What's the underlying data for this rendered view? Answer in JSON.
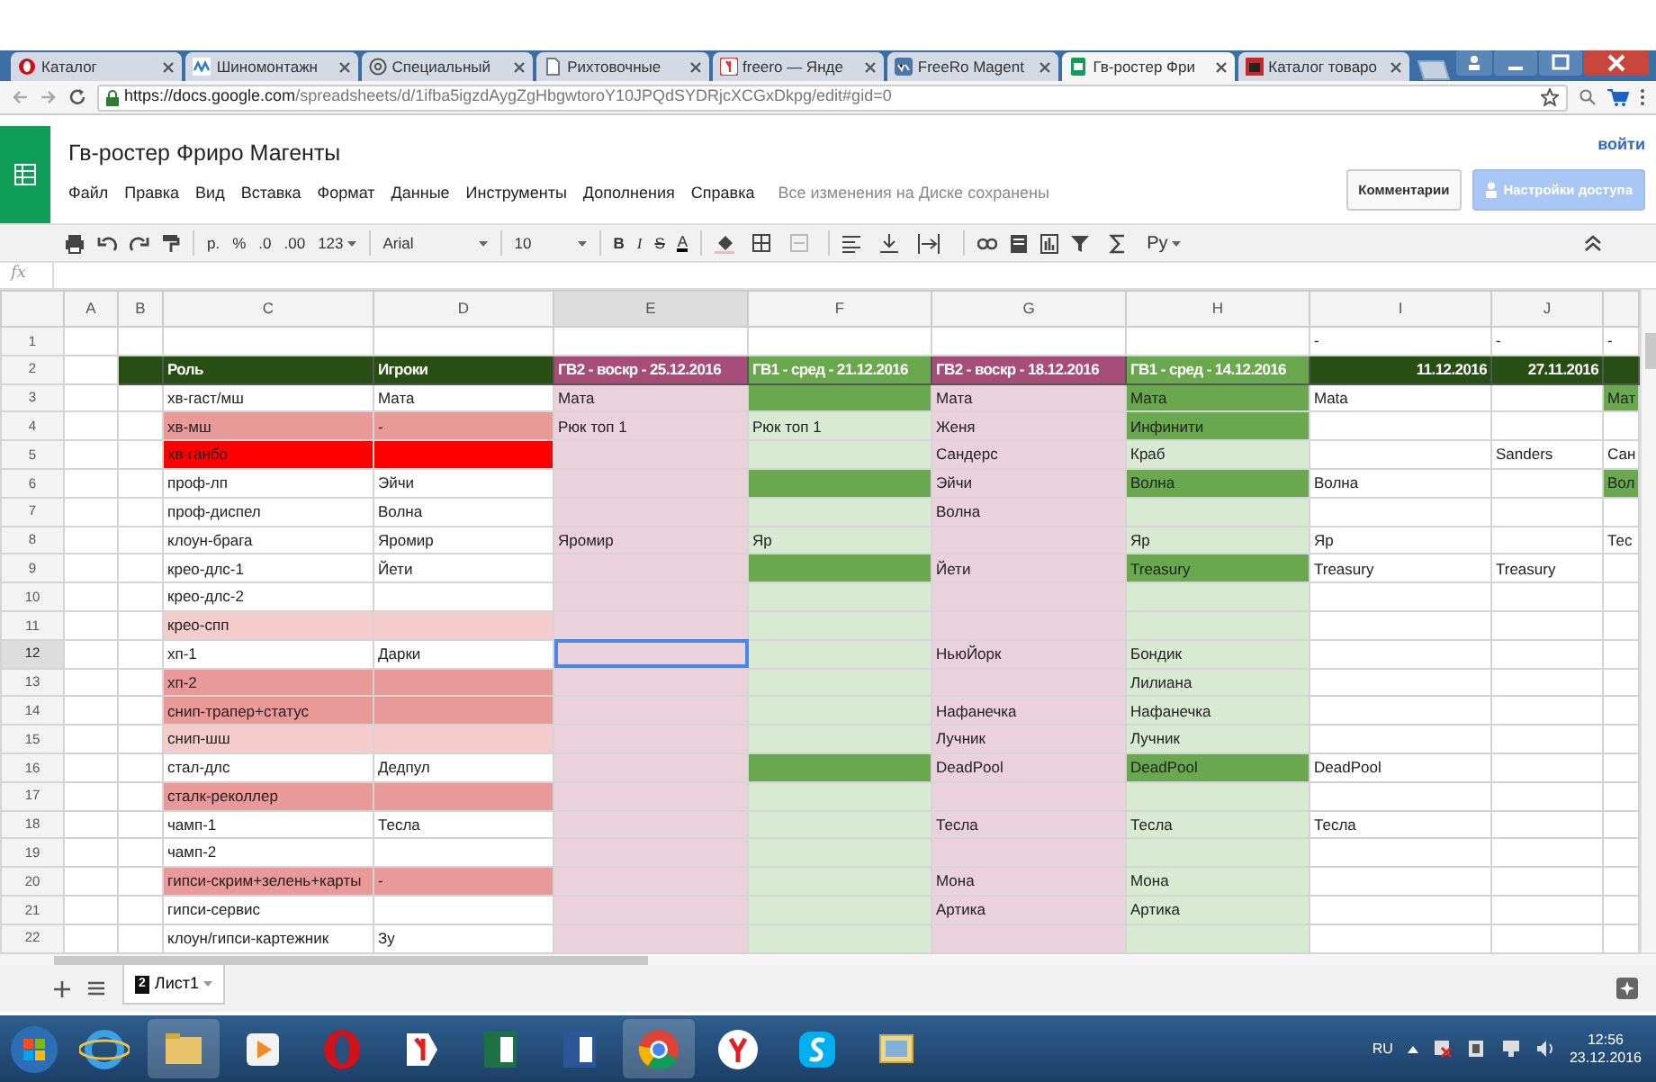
{
  "browser": {
    "tabs": [
      {
        "label": "Каталог",
        "selected": false
      },
      {
        "label": "Шиномонтажн",
        "selected": false
      },
      {
        "label": "Специальный",
        "selected": false
      },
      {
        "label": "Рихтовочные",
        "selected": false
      },
      {
        "label": "freero — Янде",
        "selected": false
      },
      {
        "label": "FreeRo Magent",
        "selected": false
      },
      {
        "label": "Гв-ростер Фри",
        "selected": true
      },
      {
        "label": "Каталог товаро",
        "selected": false
      }
    ],
    "url": {
      "host": "https://docs.google.com",
      "path": "/spreadsheets/d/1ifba5igzdAygZgHbgwtoroY10JPQdSYDRjcXCGxDkpg/edit#gid=0"
    }
  },
  "doc": {
    "title": "Гв-ростер Фриро Магенты",
    "menu": [
      "Файл",
      "Правка",
      "Вид",
      "Вставка",
      "Формат",
      "Данные",
      "Инструменты",
      "Дополнения",
      "Справка"
    ],
    "save_status": "Все изменения на Диске сохранены",
    "sign_in": "войти",
    "buttons": [
      {
        "label": "Комментарии",
        "kind": "secondary"
      },
      {
        "label": "Настройки доступа",
        "kind": "share"
      }
    ]
  },
  "toolbar": {
    "currency": "р.",
    "percent": "%",
    "decrease_decimals": ".0",
    "increase_decimals": ".00",
    "number_format": "123",
    "font": "Arial",
    "font_size": "10",
    "bold": "B",
    "italic": "I",
    "strikethrough": "S",
    "text_color": "A",
    "input_tools": "Ру"
  },
  "formula_bar": {
    "label": "fx"
  },
  "sheet": {
    "columns": [
      {
        "label": "A",
        "selected": false
      },
      {
        "label": "B",
        "selected": false
      },
      {
        "label": "C",
        "selected": false
      },
      {
        "label": "D",
        "selected": false
      },
      {
        "label": "E",
        "selected": true
      },
      {
        "label": "F",
        "selected": false
      },
      {
        "label": "G",
        "selected": false
      },
      {
        "label": "H",
        "selected": false
      },
      {
        "label": "I",
        "selected": false
      },
      {
        "label": "J",
        "selected": false
      },
      {
        "selected": false
      }
    ],
    "rows": [
      {
        "number": "1",
        "selected": false,
        "kind": "plain",
        "cells": [
          {
            "color": "#ffffff"
          },
          {
            "color": "#ffffff"
          },
          {
            "color": "#ffffff"
          },
          {
            "color": "#ffffff"
          },
          {
            "color": "#ffffff"
          },
          {
            "color": "#ffffff"
          },
          {
            "color": "#ffffff"
          },
          {
            "color": "#ffffff"
          },
          {
            "color": "#ffffff",
            "text": "-"
          },
          {
            "color": "#ffffff",
            "text": "-"
          },
          {
            "color": "#ffffff",
            "text": "-"
          }
        ]
      },
      {
        "number": "2",
        "selected": false,
        "kind": "header",
        "cells": [
          {
            "color": "#ffffff"
          },
          {
            "color": "#274e13"
          },
          {
            "color": "#274e13",
            "text": "Роль"
          },
          {
            "color": "#274e13",
            "text": "Игроки"
          },
          {
            "color": "#a64d79",
            "text": "ГВ2 - воскр - 25.12.2016"
          },
          {
            "color": "#6aa84f",
            "text": "ГВ1 - сред - 21.12.2016"
          },
          {
            "color": "#a64d79",
            "text": "ГВ2 - воскр - 18.12.2016"
          },
          {
            "color": "#6aa84f",
            "text": "ГВ1 - сред - 14.12.2016"
          },
          {
            "color": "#274e13",
            "text": "11.12.2016"
          },
          {
            "color": "#274e13",
            "text": "27.11.2016"
          },
          {
            "color": "#274e13"
          }
        ]
      },
      {
        "number": "3",
        "selected": false,
        "kind": "plain",
        "cells": [
          {
            "color": "#ffffff"
          },
          {
            "color": "#ffffff"
          },
          {
            "color": "#ffffff",
            "text": "хв-гаст/мш"
          },
          {
            "color": "#ffffff",
            "text": "Мата"
          },
          {
            "color": "#ead1dc",
            "text": "Мата"
          },
          {
            "color": "#6aa84f"
          },
          {
            "color": "#ead1dc",
            "text": "Мата"
          },
          {
            "color": "#6aa84f",
            "text": "Мата"
          },
          {
            "color": "#ffffff",
            "text": "Mata"
          },
          {
            "color": "#ffffff"
          },
          {
            "color": "#6aa84f",
            "text": "Мат"
          }
        ]
      },
      {
        "number": "4",
        "selected": false,
        "kind": "plain",
        "cells": [
          {
            "color": "#ffffff"
          },
          {
            "color": "#ffffff"
          },
          {
            "color": "#ea9999",
            "text": "хв-мш"
          },
          {
            "color": "#ea9999",
            "text": "-"
          },
          {
            "color": "#ead1dc",
            "text": "Рюк топ 1"
          },
          {
            "color": "#d9ead3",
            "text": "Рюк топ 1"
          },
          {
            "color": "#ead1dc",
            "text": "Женя"
          },
          {
            "color": "#6aa84f",
            "text": "Инфинити"
          },
          {
            "color": "#ffffff"
          },
          {
            "color": "#ffffff"
          },
          {
            "color": "#ffffff"
          }
        ]
      },
      {
        "number": "5",
        "selected": false,
        "kind": "plain",
        "cells": [
          {
            "color": "#ffffff"
          },
          {
            "color": "#ffffff"
          },
          {
            "color": "#ff0000",
            "text": "хв-ганбо"
          },
          {
            "color": "#ff0000"
          },
          {
            "color": "#ead1dc"
          },
          {
            "color": "#d9ead3"
          },
          {
            "color": "#ead1dc",
            "text": "Сандерс"
          },
          {
            "color": "#d9ead3",
            "text": "Краб"
          },
          {
            "color": "#ffffff"
          },
          {
            "color": "#ffffff",
            "text": "Sanders"
          },
          {
            "color": "#ffffff",
            "text": "Сан"
          }
        ]
      },
      {
        "number": "6",
        "selected": false,
        "kind": "plain",
        "cells": [
          {
            "color": "#ffffff"
          },
          {
            "color": "#ffffff"
          },
          {
            "color": "#ffffff",
            "text": "проф-лп"
          },
          {
            "color": "#ffffff",
            "text": "Эйчи"
          },
          {
            "color": "#ead1dc"
          },
          {
            "color": "#6aa84f"
          },
          {
            "color": "#ead1dc",
            "text": "Эйчи"
          },
          {
            "color": "#6aa84f",
            "text": "Волна"
          },
          {
            "color": "#ffffff",
            "text": "Волна"
          },
          {
            "color": "#ffffff"
          },
          {
            "color": "#6aa84f",
            "text": "Вол"
          }
        ]
      },
      {
        "number": "7",
        "selected": false,
        "kind": "plain",
        "cells": [
          {
            "color": "#ffffff"
          },
          {
            "color": "#ffffff"
          },
          {
            "color": "#ffffff",
            "text": "проф-диспел"
          },
          {
            "color": "#ffffff",
            "text": "Волна"
          },
          {
            "color": "#ead1dc"
          },
          {
            "color": "#d9ead3"
          },
          {
            "color": "#ead1dc",
            "text": "Волна"
          },
          {
            "color": "#d9ead3"
          },
          {
            "color": "#ffffff"
          },
          {
            "color": "#ffffff"
          },
          {
            "color": "#ffffff"
          }
        ]
      },
      {
        "number": "8",
        "selected": false,
        "kind": "plain",
        "cells": [
          {
            "color": "#ffffff"
          },
          {
            "color": "#ffffff"
          },
          {
            "color": "#ffffff",
            "text": "клоун-брага"
          },
          {
            "color": "#ffffff",
            "text": "Яромир"
          },
          {
            "color": "#ead1dc",
            "text": "Яромир"
          },
          {
            "color": "#d9ead3",
            "text": "Яр"
          },
          {
            "color": "#ead1dc"
          },
          {
            "color": "#d9ead3",
            "text": "Яр"
          },
          {
            "color": "#ffffff",
            "text": "Яр"
          },
          {
            "color": "#ffffff"
          },
          {
            "color": "#ffffff",
            "text": "Тес"
          }
        ]
      },
      {
        "number": "9",
        "selected": false,
        "kind": "plain",
        "cells": [
          {
            "color": "#ffffff"
          },
          {
            "color": "#ffffff"
          },
          {
            "color": "#ffffff",
            "text": "крео-длс-1"
          },
          {
            "color": "#ffffff",
            "text": "Йети"
          },
          {
            "color": "#ead1dc"
          },
          {
            "color": "#6aa84f"
          },
          {
            "color": "#ead1dc",
            "text": "Йети"
          },
          {
            "color": "#6aa84f",
            "text": "Treasury"
          },
          {
            "color": "#ffffff",
            "text": "Treasury"
          },
          {
            "color": "#ffffff",
            "text": "Treasury"
          },
          {
            "color": "#ffffff"
          }
        ]
      },
      {
        "number": "10",
        "selected": false,
        "kind": "plain",
        "cells": [
          {
            "color": "#ffffff"
          },
          {
            "color": "#ffffff"
          },
          {
            "color": "#ffffff",
            "text": "крео-длс-2"
          },
          {
            "color": "#ffffff"
          },
          {
            "color": "#ead1dc"
          },
          {
            "color": "#d9ead3"
          },
          {
            "color": "#ead1dc"
          },
          {
            "color": "#d9ead3"
          },
          {
            "color": "#ffffff"
          },
          {
            "color": "#ffffff"
          },
          {
            "color": "#ffffff"
          }
        ]
      },
      {
        "number": "11",
        "selected": false,
        "kind": "plain",
        "cells": [
          {
            "color": "#ffffff"
          },
          {
            "color": "#ffffff"
          },
          {
            "color": "#f4cccc",
            "text": "крео-спп"
          },
          {
            "color": "#f4cccc"
          },
          {
            "color": "#ead1dc"
          },
          {
            "color": "#d9ead3"
          },
          {
            "color": "#ead1dc"
          },
          {
            "color": "#d9ead3"
          },
          {
            "color": "#ffffff"
          },
          {
            "color": "#ffffff"
          },
          {
            "color": "#ffffff"
          }
        ]
      },
      {
        "number": "12",
        "selected": true,
        "kind": "plain",
        "cells": [
          {
            "color": "#ffffff"
          },
          {
            "color": "#ffffff"
          },
          {
            "color": "#ffffff",
            "text": "хп-1"
          },
          {
            "color": "#ffffff",
            "text": "Дарки"
          },
          {
            "color": "#ead1dc"
          },
          {
            "color": "#d9ead3"
          },
          {
            "color": "#ead1dc",
            "text": "НьюЙорк"
          },
          {
            "color": "#d9ead3",
            "text": "Бондик"
          },
          {
            "color": "#ffffff"
          },
          {
            "color": "#ffffff"
          },
          {
            "color": "#ffffff"
          }
        ]
      },
      {
        "number": "13",
        "selected": false,
        "kind": "plain",
        "cells": [
          {
            "color": "#ffffff"
          },
          {
            "color": "#ffffff"
          },
          {
            "color": "#ea9999",
            "text": "хп-2"
          },
          {
            "color": "#ea9999"
          },
          {
            "color": "#ead1dc"
          },
          {
            "color": "#d9ead3"
          },
          {
            "color": "#ead1dc"
          },
          {
            "color": "#d9ead3",
            "text": "Лилиана"
          },
          {
            "color": "#ffffff"
          },
          {
            "color": "#ffffff"
          },
          {
            "color": "#ffffff"
          }
        ]
      },
      {
        "number": "14",
        "selected": false,
        "kind": "plain",
        "cells": [
          {
            "color": "#ffffff"
          },
          {
            "color": "#ffffff"
          },
          {
            "color": "#ea9999",
            "text": "снип-трапер+статус"
          },
          {
            "color": "#ea9999"
          },
          {
            "color": "#ead1dc"
          },
          {
            "color": "#d9ead3"
          },
          {
            "color": "#ead1dc",
            "text": "Нафанечка"
          },
          {
            "color": "#d9ead3",
            "text": "Нафанечка"
          },
          {
            "color": "#ffffff"
          },
          {
            "color": "#ffffff"
          },
          {
            "color": "#ffffff"
          }
        ]
      },
      {
        "number": "15",
        "selected": false,
        "kind": "plain",
        "cells": [
          {
            "color": "#ffffff"
          },
          {
            "color": "#ffffff"
          },
          {
            "color": "#f4cccc",
            "text": "снип-шш"
          },
          {
            "color": "#f4cccc"
          },
          {
            "color": "#ead1dc"
          },
          {
            "color": "#d9ead3"
          },
          {
            "color": "#ead1dc",
            "text": "Лучник"
          },
          {
            "color": "#d9ead3",
            "text": "Лучник"
          },
          {
            "color": "#ffffff"
          },
          {
            "color": "#ffffff"
          },
          {
            "color": "#ffffff"
          }
        ]
      },
      {
        "number": "16",
        "selected": false,
        "kind": "plain",
        "cells": [
          {
            "color": "#ffffff"
          },
          {
            "color": "#ffffff"
          },
          {
            "color": "#ffffff",
            "text": "стал-длс"
          },
          {
            "color": "#ffffff",
            "text": "Дедпул"
          },
          {
            "color": "#ead1dc"
          },
          {
            "color": "#6aa84f"
          },
          {
            "color": "#ead1dc",
            "text": "DeadPool"
          },
          {
            "color": "#6aa84f",
            "text": "DeadPool"
          },
          {
            "color": "#ffffff",
            "text": "DeadPool"
          },
          {
            "color": "#ffffff"
          },
          {
            "color": "#ffffff"
          }
        ]
      },
      {
        "number": "17",
        "selected": false,
        "kind": "plain",
        "cells": [
          {
            "color": "#ffffff"
          },
          {
            "color": "#ffffff"
          },
          {
            "color": "#ea9999",
            "text": "сталк-реколлер"
          },
          {
            "color": "#ea9999"
          },
          {
            "color": "#ead1dc"
          },
          {
            "color": "#d9ead3"
          },
          {
            "color": "#ead1dc"
          },
          {
            "color": "#d9ead3"
          },
          {
            "color": "#ffffff"
          },
          {
            "color": "#ffffff"
          },
          {
            "color": "#ffffff"
          }
        ]
      },
      {
        "number": "18",
        "selected": false,
        "kind": "plain",
        "cells": [
          {
            "color": "#ffffff"
          },
          {
            "color": "#ffffff"
          },
          {
            "color": "#ffffff",
            "text": "чамп-1"
          },
          {
            "color": "#ffffff",
            "text": "Тесла"
          },
          {
            "color": "#ead1dc"
          },
          {
            "color": "#d9ead3"
          },
          {
            "color": "#ead1dc",
            "text": "Тесла"
          },
          {
            "color": "#d9ead3",
            "text": "Тесла"
          },
          {
            "color": "#ffffff",
            "text": "Тесла"
          },
          {
            "color": "#ffffff"
          },
          {
            "color": "#ffffff"
          }
        ]
      },
      {
        "number": "19",
        "selected": false,
        "kind": "plain",
        "cells": [
          {
            "color": "#ffffff"
          },
          {
            "color": "#ffffff"
          },
          {
            "color": "#ffffff",
            "text": "чамп-2"
          },
          {
            "color": "#ffffff"
          },
          {
            "color": "#ead1dc"
          },
          {
            "color": "#d9ead3"
          },
          {
            "color": "#ead1dc"
          },
          {
            "color": "#d9ead3"
          },
          {
            "color": "#ffffff"
          },
          {
            "color": "#ffffff"
          },
          {
            "color": "#ffffff"
          }
        ]
      },
      {
        "number": "20",
        "selected": false,
        "kind": "plain",
        "cells": [
          {
            "color": "#ffffff"
          },
          {
            "color": "#ffffff"
          },
          {
            "color": "#ea9999",
            "text": "гипси-скрим+зелень+карты"
          },
          {
            "color": "#ea9999",
            "text": "-"
          },
          {
            "color": "#ead1dc"
          },
          {
            "color": "#d9ead3"
          },
          {
            "color": "#ead1dc",
            "text": "Мона"
          },
          {
            "color": "#d9ead3",
            "text": "Мона"
          },
          {
            "color": "#ffffff"
          },
          {
            "color": "#ffffff"
          },
          {
            "color": "#ffffff"
          }
        ]
      },
      {
        "number": "21",
        "selected": false,
        "kind": "plain",
        "cells": [
          {
            "color": "#ffffff"
          },
          {
            "color": "#ffffff"
          },
          {
            "color": "#ffffff",
            "text": "гипси-сервис"
          },
          {
            "color": "#ffffff"
          },
          {
            "color": "#ead1dc"
          },
          {
            "color": "#d9ead3"
          },
          {
            "color": "#ead1dc",
            "text": "Артика"
          },
          {
            "color": "#d9ead3",
            "text": "Артика"
          },
          {
            "color": "#ffffff"
          },
          {
            "color": "#ffffff"
          },
          {
            "color": "#ffffff"
          }
        ]
      },
      {
        "number": "22",
        "selected": false,
        "kind": "plain",
        "cells": [
          {
            "color": "#ffffff"
          },
          {
            "color": "#ffffff"
          },
          {
            "color": "#ffffff",
            "text": "клоун/гипси-картежник"
          },
          {
            "color": "#ffffff",
            "text": "Зу"
          },
          {
            "color": "#ead1dc"
          },
          {
            "color": "#d9ead3"
          },
          {
            "color": "#ead1dc"
          },
          {
            "color": "#d9ead3"
          },
          {
            "color": "#ffffff"
          },
          {
            "color": "#ffffff"
          },
          {
            "color": "#ffffff"
          }
        ]
      }
    ]
  },
  "sheet_tabs": [
    {
      "label": "Лист1",
      "badge": "2",
      "selected": true
    }
  ],
  "taskbar": {
    "language": "RU",
    "time": "12:56",
    "date": "23.12.2016"
  }
}
